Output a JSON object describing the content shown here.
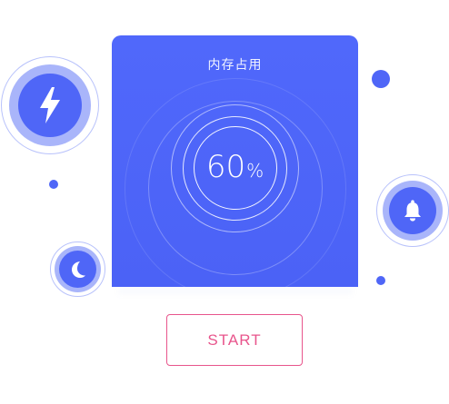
{
  "memory_card": {
    "title": "内存占用",
    "usage_value": "60",
    "usage_unit": "%",
    "usage_fraction": 0.6
  },
  "start_button": {
    "label": "START"
  },
  "icons": {
    "bolt": "lightning-icon",
    "bell": "bell-icon",
    "moon": "moon-icon"
  },
  "colors": {
    "primary": "#4f66f7",
    "primary_light": "#a9b5fa",
    "accent": "#e8558c",
    "background": "#ffffff"
  }
}
